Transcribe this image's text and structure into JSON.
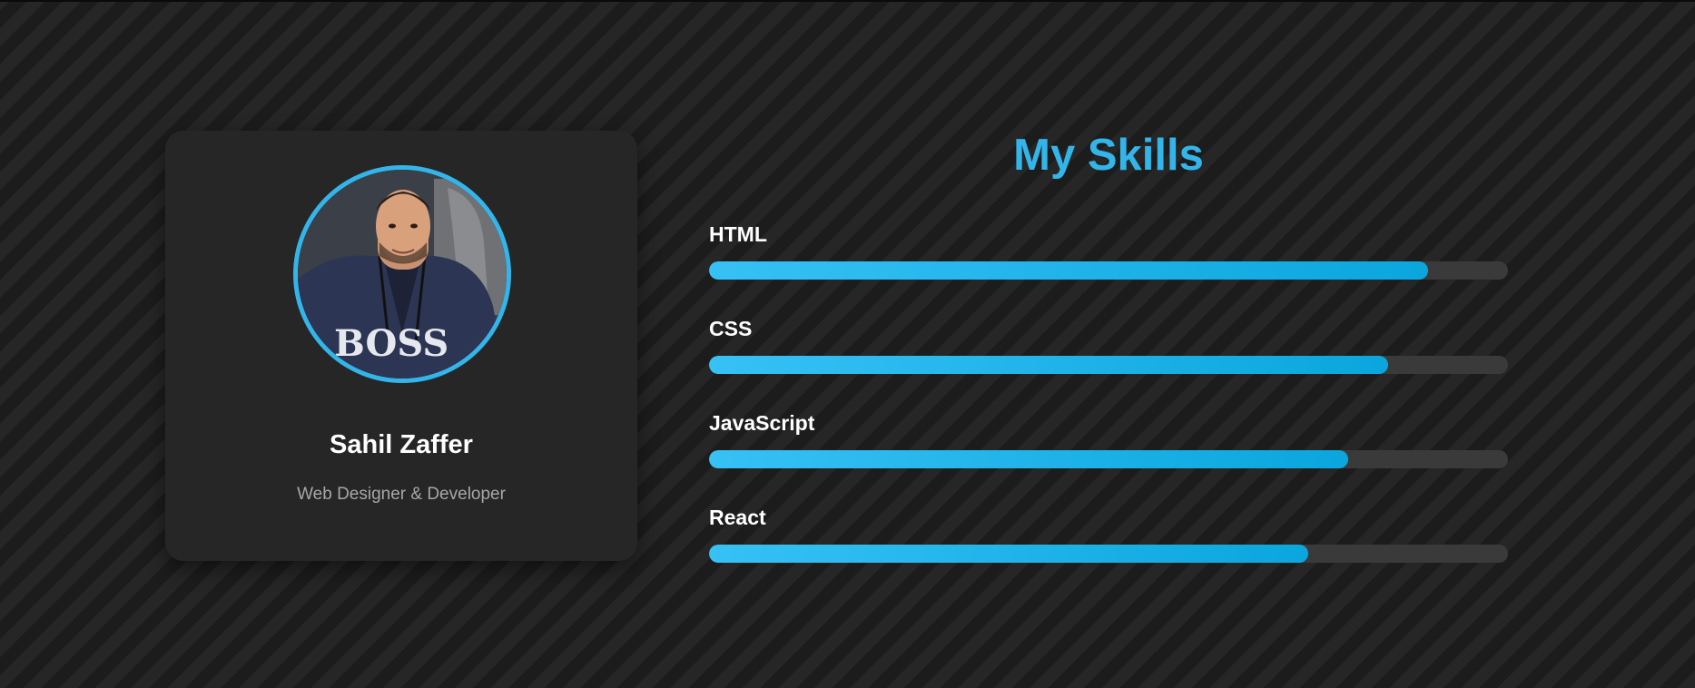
{
  "profile": {
    "name": "Sahil Zaffer",
    "role": "Web Designer & Developer",
    "avatar_icon": "profile-photo",
    "accent_color": "#33b5ea"
  },
  "skills": {
    "title": "My Skills",
    "items": [
      {
        "label": "HTML",
        "percent": 90
      },
      {
        "label": "CSS",
        "percent": 85
      },
      {
        "label": "JavaScript",
        "percent": 80
      },
      {
        "label": "React",
        "percent": 75
      }
    ]
  },
  "colors": {
    "accent": "#33b5ea",
    "bar_start": "#37c1f5",
    "bar_end": "#0aa6dd",
    "track": "#3a3a3a",
    "card": "#262626"
  }
}
